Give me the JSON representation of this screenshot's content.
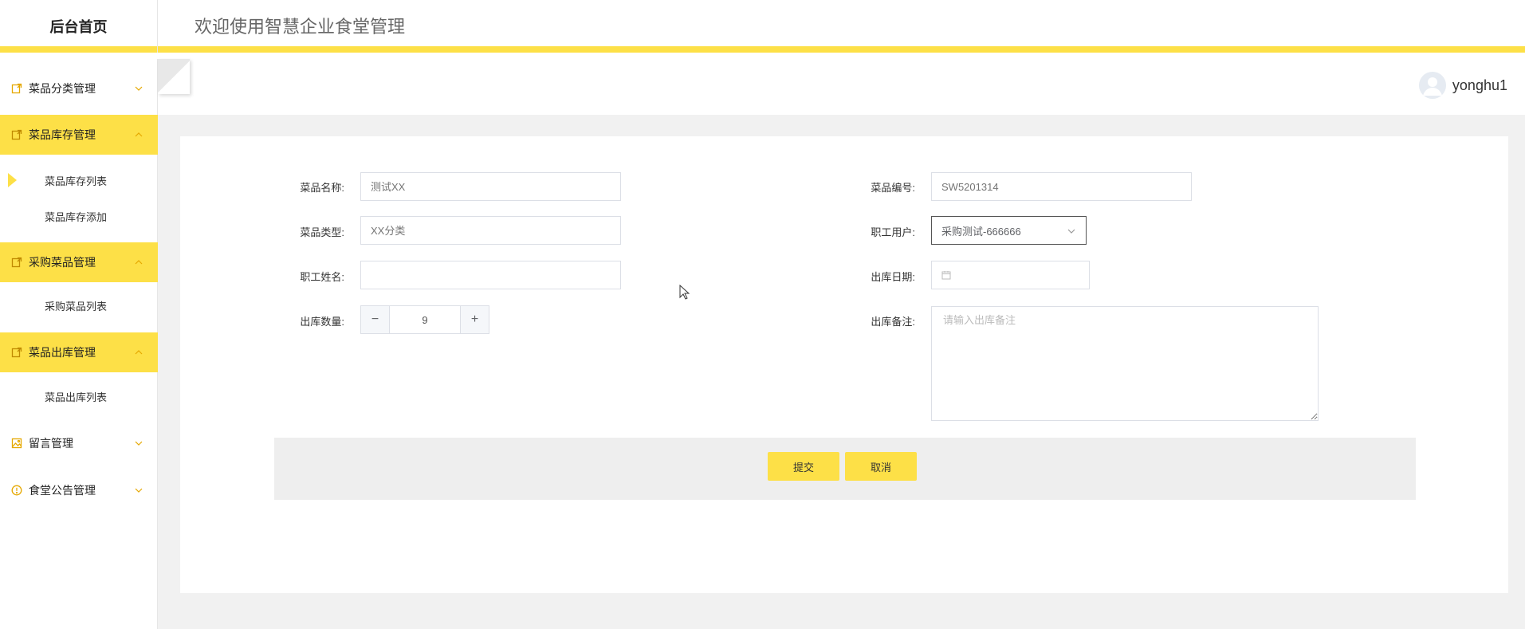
{
  "header": {
    "brand": "后台首页",
    "welcome": "欢迎使用智慧企业食堂管理"
  },
  "sidebar": {
    "menus": [
      {
        "label": "菜品分类管理",
        "icon": "document-icon",
        "expanded": false
      },
      {
        "label": "菜品库存管理",
        "icon": "document-icon",
        "expanded": true,
        "children": [
          "菜品库存列表",
          "菜品库存添加"
        ],
        "active_child": "菜品库存列表"
      },
      {
        "label": "采购菜品管理",
        "icon": "document-icon",
        "expanded": true,
        "children": [
          "采购菜品列表"
        ]
      },
      {
        "label": "菜品出库管理",
        "icon": "document-icon",
        "expanded": true,
        "children": [
          "菜品出库列表"
        ]
      },
      {
        "label": "留言管理",
        "icon": "image-icon",
        "expanded": false
      },
      {
        "label": "食堂公告管理",
        "icon": "info-circle-icon",
        "expanded": false
      }
    ]
  },
  "user": {
    "name": "yonghu1"
  },
  "form": {
    "dish_name": {
      "label": "菜品名称:",
      "placeholder": "测试XX"
    },
    "dish_code": {
      "label": "菜品编号:",
      "placeholder": "SW5201314"
    },
    "dish_type": {
      "label": "菜品类型:",
      "placeholder": "XX分类"
    },
    "staff_user": {
      "label": "职工用户:",
      "value": "采购测试-666666"
    },
    "staff_name": {
      "label": "职工姓名:",
      "value": ""
    },
    "out_date": {
      "label": "出库日期:",
      "value": ""
    },
    "quantity": {
      "label": "出库数量:",
      "value": "9"
    },
    "remark": {
      "label": "出库备注:",
      "placeholder": "请输入出库备注"
    }
  },
  "actions": {
    "submit": "提交",
    "cancel": "取消"
  },
  "colors": {
    "accent": "#fde047",
    "icon": "#e5a800"
  }
}
